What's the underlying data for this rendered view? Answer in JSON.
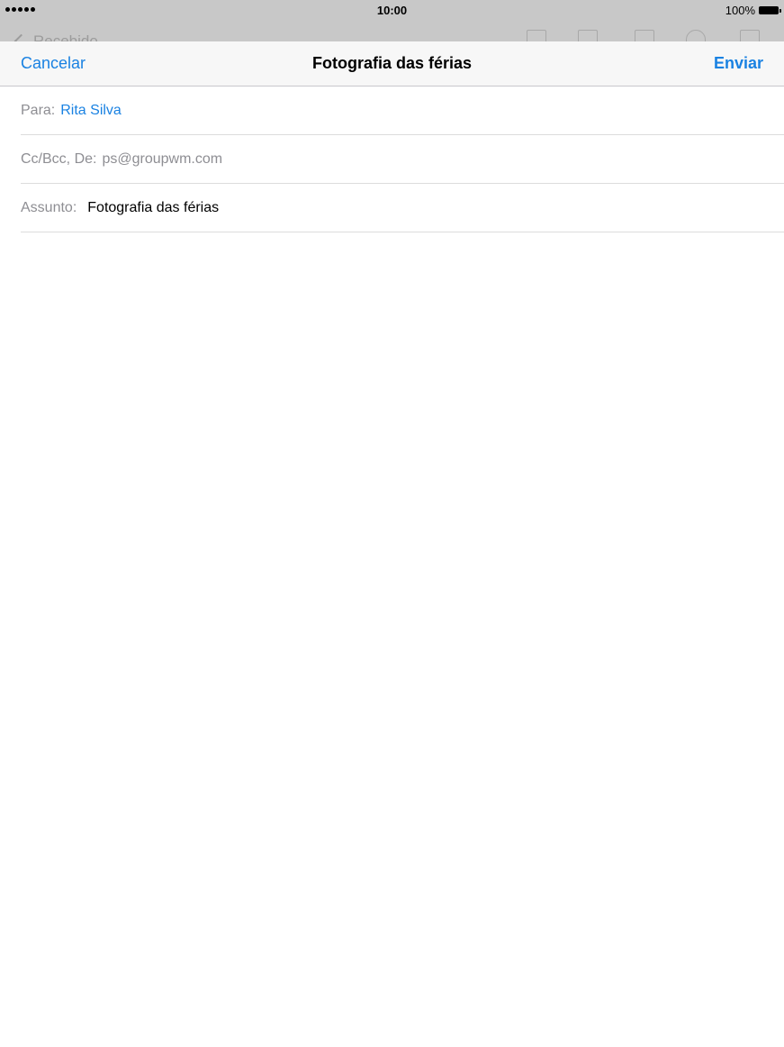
{
  "status_bar": {
    "time": "10:00",
    "battery": "100%"
  },
  "background": {
    "back_label": "Recebido"
  },
  "compose": {
    "cancel_label": "Cancelar",
    "title": "Fotografia das férias",
    "send_label": "Enviar",
    "to_label": "Para:",
    "to_value": "Rita Silva",
    "from_label": "Cc/Bcc, De:",
    "from_value": "ps@groupwm.com",
    "subject_label": "Assunto:",
    "subject_value": "Fotografia das férias"
  },
  "colors": {
    "accent": "#1a82e2",
    "label_gray": "#8e8e93"
  }
}
